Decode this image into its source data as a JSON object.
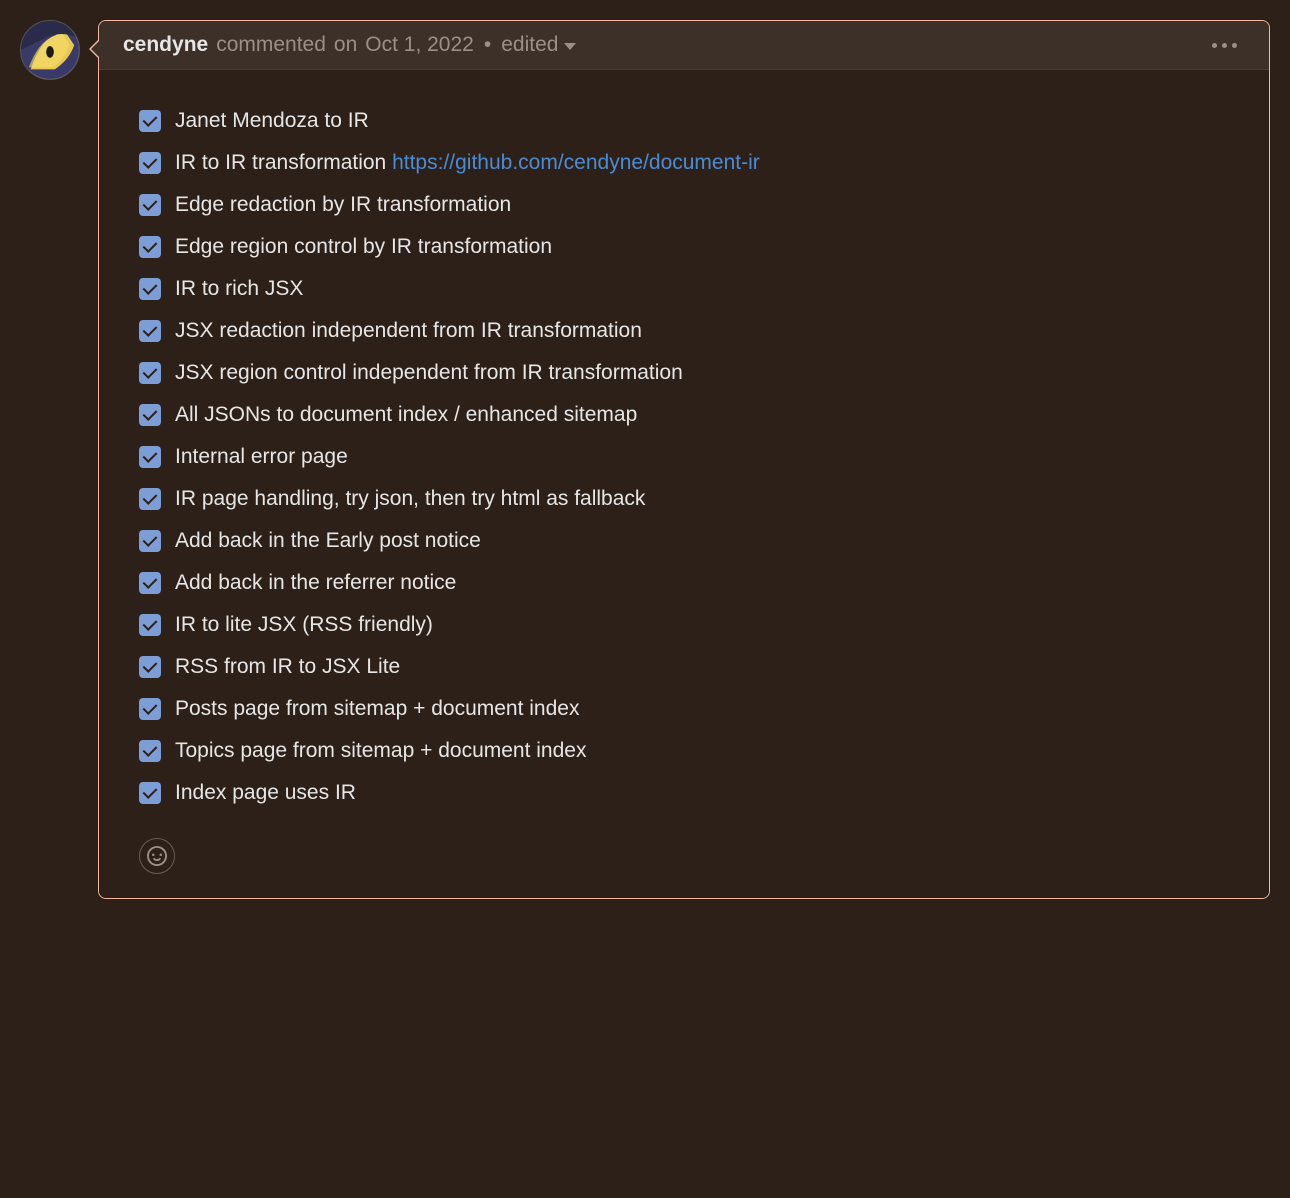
{
  "comment": {
    "author": "cendyne",
    "action_text": "commented",
    "timestamp_prefix": "on",
    "timestamp": "Oct 1, 2022",
    "edited_label": "edited",
    "tasks": [
      {
        "checked": true,
        "text": "Janet Mendoza to IR",
        "link": null
      },
      {
        "checked": true,
        "text": "IR to IR transformation ",
        "link": {
          "href": "https://github.com/cendyne/document-ir",
          "label": "https://github.com/cendyne/document-ir"
        }
      },
      {
        "checked": true,
        "text": "Edge redaction by IR transformation",
        "link": null
      },
      {
        "checked": true,
        "text": "Edge region control by IR transformation",
        "link": null
      },
      {
        "checked": true,
        "text": "IR to rich JSX",
        "link": null
      },
      {
        "checked": true,
        "text": "JSX redaction independent from IR transformation",
        "link": null
      },
      {
        "checked": true,
        "text": "JSX region control independent from IR transformation",
        "link": null
      },
      {
        "checked": true,
        "text": "All JSONs to document index / enhanced sitemap",
        "link": null
      },
      {
        "checked": true,
        "text": "Internal error page",
        "link": null
      },
      {
        "checked": true,
        "text": "IR page handling, try json, then try html as fallback",
        "link": null
      },
      {
        "checked": true,
        "text": "Add back in the Early post notice",
        "link": null
      },
      {
        "checked": true,
        "text": "Add back in the referrer notice",
        "link": null
      },
      {
        "checked": true,
        "text": "IR to lite JSX (RSS friendly)",
        "link": null
      },
      {
        "checked": true,
        "text": "RSS from IR to JSX Lite",
        "link": null
      },
      {
        "checked": true,
        "text": "Posts page from sitemap + document index",
        "link": null
      },
      {
        "checked": true,
        "text": "Topics page from sitemap + document index",
        "link": null
      },
      {
        "checked": true,
        "text": "Index page uses IR",
        "link": null
      }
    ]
  }
}
